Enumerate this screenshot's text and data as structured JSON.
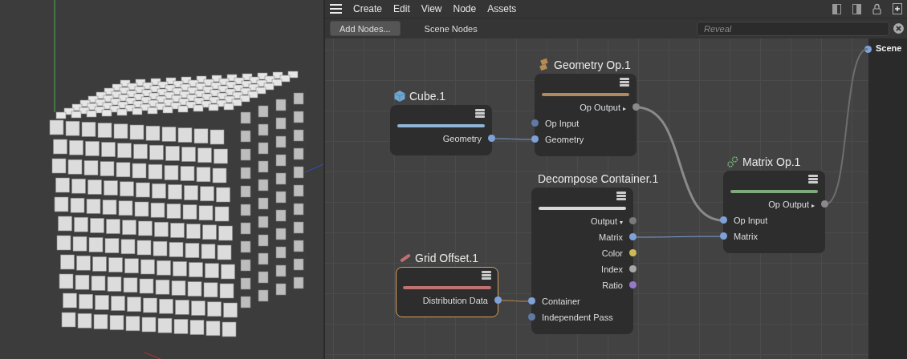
{
  "menu": [
    "Create",
    "Edit",
    "View",
    "Node",
    "Assets"
  ],
  "toolbar": {
    "add_button": "Add Nodes...",
    "title": "Scene Nodes",
    "search": {
      "placeholder": "Reveal"
    }
  },
  "nodes": [
    {
      "title": "Cube.1",
      "color": "#8fb5d6",
      "selected": false,
      "ports": [
        {
          "label": "Geometry",
          "kind": "output",
          "color": "#7ea2d8"
        }
      ]
    },
    {
      "title": "Geometry Op.1",
      "color": "#b08a5e",
      "selected": false,
      "ports": [
        {
          "label": "Op Output",
          "kind": "output",
          "arrow": "▸",
          "color": "#8a8a8a"
        },
        {
          "label": "Op Input",
          "kind": "input",
          "color": "#5f7aa3"
        },
        {
          "label": "Geometry",
          "kind": "input",
          "color": "#7ea2d8"
        }
      ]
    },
    {
      "title": "Decompose Container.1",
      "color": "#d8d8d8",
      "selected": false,
      "ports": [
        {
          "label": "Output",
          "kind": "output",
          "arrow": "▾",
          "color": "#7a7a7a"
        },
        {
          "label": "Matrix",
          "kind": "output",
          "color": "#7ea2d8"
        },
        {
          "label": "Color",
          "kind": "output",
          "color": "#cdb95a"
        },
        {
          "label": "Index",
          "kind": "output",
          "color": "#a8a8a8"
        },
        {
          "label": "Ratio",
          "kind": "output",
          "color": "#9479c9"
        },
        {
          "label": "Container",
          "kind": "input",
          "color": "#7ea2d8"
        },
        {
          "label": "Independent Pass",
          "kind": "input",
          "color": "#5f7aa3"
        }
      ]
    },
    {
      "title": "Grid Offset.1",
      "color": "#c07272",
      "selected": true,
      "ports": [
        {
          "label": "Distribution Data",
          "kind": "output",
          "color": "#7ea2d8"
        }
      ]
    },
    {
      "title": "Matrix Op.1",
      "color": "#7faa7a",
      "selected": false,
      "ports": [
        {
          "label": "Op Output",
          "kind": "output",
          "arrow": "▸",
          "color": "#8a8a8a"
        },
        {
          "label": "Op Input",
          "kind": "input",
          "color": "#7ea2d8"
        },
        {
          "label": "Matrix",
          "kind": "input",
          "color": "#7ea2d8"
        }
      ]
    }
  ],
  "scene_panel": {
    "label": "Scene"
  }
}
